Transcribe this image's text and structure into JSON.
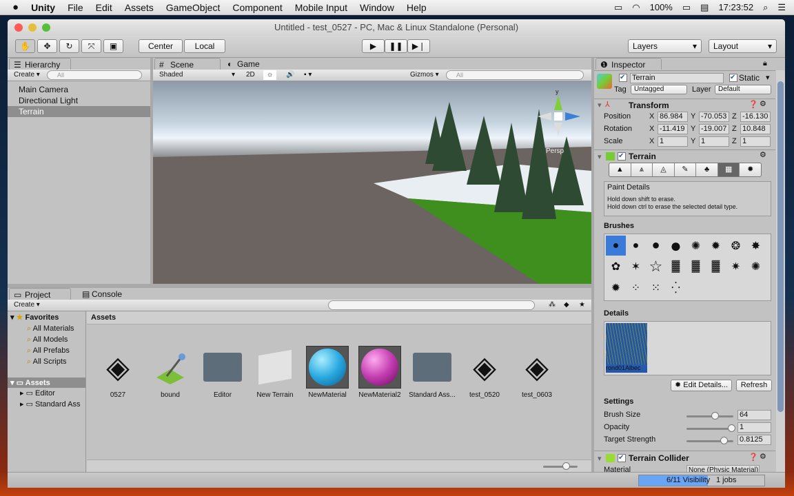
{
  "menubar": {
    "apple": "",
    "items": [
      "Unity",
      "File",
      "Edit",
      "Assets",
      "GameObject",
      "Component",
      "Mobile Input",
      "Window",
      "Help"
    ],
    "battery": "100%",
    "clock": "17:23:52"
  },
  "window": {
    "title": "Untitled - test_0527 - PC, Mac & Linux Standalone (Personal)"
  },
  "toolbar": {
    "center": "Center",
    "local": "Local",
    "layers": "Layers",
    "layout": "Layout"
  },
  "hierarchy": {
    "tab": "Hierarchy",
    "create": "Create",
    "search_placeholder": "All",
    "items": [
      "Main Camera",
      "Directional Light",
      "Terrain"
    ],
    "selected": "Terrain"
  },
  "scene": {
    "tab_scene": "Scene",
    "tab_game": "Game",
    "shading": "Shaded",
    "mode2d": "2D",
    "gizmos": "Gizmos",
    "search_placeholder": "All",
    "persp": "Persp",
    "gizmo_y": "y"
  },
  "project": {
    "tab": "Project",
    "console_tab": "Console",
    "create": "Create",
    "favorites": "Favorites",
    "favorite_items": [
      "All Materials",
      "All Models",
      "All Prefabs",
      "All Scripts"
    ],
    "assets_root": "Assets",
    "folders": [
      "Editor",
      "Standard Assets"
    ],
    "folder_display": [
      "Editor",
      "Standard Ass"
    ],
    "breadcrumb": "Assets",
    "assets": [
      {
        "name": "0527",
        "type": "unity"
      },
      {
        "name": "bound",
        "type": "terrain-data"
      },
      {
        "name": "Editor",
        "type": "folder"
      },
      {
        "name": "New Terrain",
        "type": "terrain"
      },
      {
        "name": "NewMaterial",
        "type": "material-blue"
      },
      {
        "name": "NewMaterial2",
        "type": "material-magenta"
      },
      {
        "name": "Standard Ass...",
        "type": "folder"
      },
      {
        "name": "test_0520",
        "type": "unity"
      },
      {
        "name": "test_0603",
        "type": "unity"
      }
    ]
  },
  "inspector": {
    "tab": "Inspector",
    "name": "Terrain",
    "static": "Static",
    "tag_label": "Tag",
    "tag": "Untagged",
    "layer_label": "Layer",
    "layer": "Default",
    "transform": {
      "title": "Transform",
      "rows": [
        {
          "label": "Position",
          "x": "86.984",
          "y": "-70.053",
          "z": "-16.130"
        },
        {
          "label": "Rotation",
          "x": "-11.419",
          "y": "-19.007",
          "z": "10.848"
        },
        {
          "label": "Scale",
          "x": "1",
          "y": "1",
          "z": "1"
        }
      ],
      "axes": [
        "X",
        "Y",
        "Z"
      ]
    },
    "terrain": {
      "title": "Terrain",
      "tool_title": "Paint Details",
      "hint1": "Hold down shift to erase.",
      "hint2": "Hold down ctrl to erase the selected detail type.",
      "brushes_label": "Brushes",
      "details_label": "Details",
      "detail_item": "rond01Albedo",
      "detail_item_display": "rond01Albec",
      "edit_details": "Edit Details...",
      "refresh": "Refresh",
      "settings_label": "Settings",
      "settings": [
        {
          "label": "Brush Size",
          "value": "64",
          "fraction": 0.6
        },
        {
          "label": "Opacity",
          "value": "1",
          "fraction": 1.0
        },
        {
          "label": "Target Strength",
          "value": "0.8125",
          "fraction": 0.8125
        }
      ]
    },
    "collider": {
      "title": "Terrain Collider",
      "material_label": "Material",
      "material": "None (Physic Material)"
    }
  },
  "status": {
    "visibility": "6/11 Visibility",
    "jobs": "1 jobs",
    "progress": 0.55
  }
}
